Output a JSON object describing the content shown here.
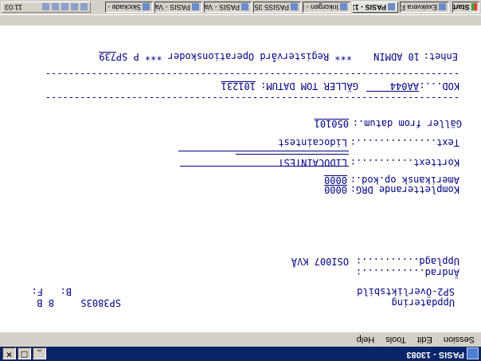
{
  "window": {
    "title": "PASIS - 13083"
  },
  "menu": [
    "Session",
    "Edit",
    "Tools",
    "Help"
  ],
  "screen": {
    "title": "Uppdatering",
    "subtitle": "SP2-Överliktsbild",
    "code": "SP3803S",
    "b_label": "B:",
    "f_label": "F:",
    "page_indicator": "8 B",
    "changed_label": "Ändrad...........:",
    "created_label": "Upplagd..........:",
    "created_value": "OSI007 KVÅ",
    "comp_label": "Kompletterande DRG:",
    "comp_value": "0000",
    "amer_label": "Amerikansk op.kod.:",
    "amer_value": "0000",
    "shorttext_label": "Korttext..........:",
    "shorttext_value": "LIDOCAINTEST",
    "text_label": "Text..............:",
    "text_value": "Lidocaintest",
    "valid_label": "Gäller from datum.:",
    "valid_value": "050101",
    "kod_label": "KOD...:",
    "kod_value": "AA044",
    "valid_tom_label": "GÄLLER TOM DATUM:",
    "valid_tom_value": "101231",
    "unit_label": "Enhet:",
    "unit_value": "10 ADMIN",
    "footer_text": "*** Registervård Operationskoder *** P SP",
    "footer_value": "739",
    "separator": "------------------------------------------------------------------------"
  },
  "taskbar": {
    "start": "Start",
    "tasks": [
      "Exekvera F...",
      "PASIS - 13083",
      "Inkorgen - Mi...",
      "PASIS5 35...",
      "PASIS - Vad...",
      "PASIS - Vad...",
      "Skickade - Mi..."
    ],
    "clock": "11:03"
  }
}
